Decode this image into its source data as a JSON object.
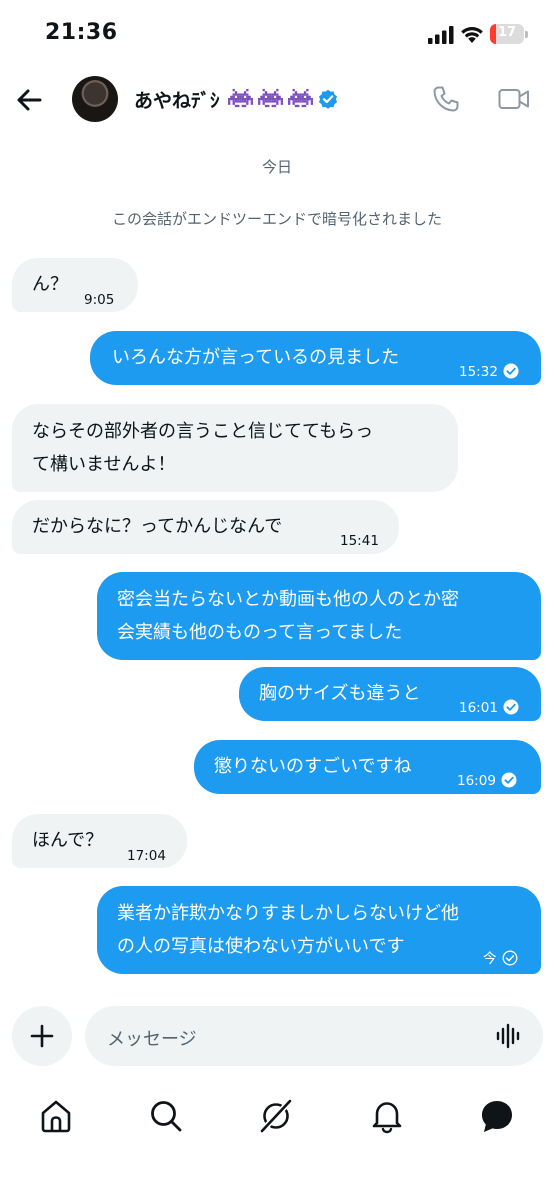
{
  "status_bar": {
    "time": "21:36",
    "battery_level": "17"
  },
  "header": {
    "name": "あやねﾃﾞｼ",
    "emoji": [
      "alien-monster",
      "alien-monster",
      "alien-monster"
    ]
  },
  "date_separator": "今日",
  "e2e_notice": "この会話がエンドツーエンドで暗号化されました",
  "messages": [
    {
      "dir": "in",
      "lines": [
        "ん？"
      ],
      "time": "9:05"
    },
    {
      "dir": "out",
      "lines": [
        "いろんな方が言っているの見ました"
      ],
      "time": "15:32"
    },
    {
      "dir": "in",
      "lines": [
        "ならその部外者の言うこと信じててもらっ",
        "て構いませんよ！"
      ]
    },
    {
      "dir": "in",
      "lines": [
        "だからなに？ってかんじなんで"
      ],
      "time": "15:41"
    },
    {
      "dir": "out",
      "lines": [
        "密会当たらないとか動画も他の人のとか密",
        "会実績も他のものって言ってました"
      ]
    },
    {
      "dir": "out",
      "lines": [
        "胸のサイズも違うと"
      ],
      "time": "16:01"
    },
    {
      "dir": "out",
      "lines": [
        "懲りないのすごいですね"
      ],
      "time": "16:09"
    },
    {
      "dir": "in",
      "lines": [
        "ほんで？"
      ],
      "time": "17:04"
    },
    {
      "dir": "out",
      "lines": [
        "業者か詐欺かなりすましかしらないけど他",
        "の人の写真は使わない方がいいです"
      ],
      "time": "今"
    }
  ],
  "composer": {
    "placeholder": "メッセージ"
  },
  "colors": {
    "accent": "#1d9bf0",
    "incoming_bubble": "#eff3f4",
    "battery_low": "#ff3b30"
  }
}
